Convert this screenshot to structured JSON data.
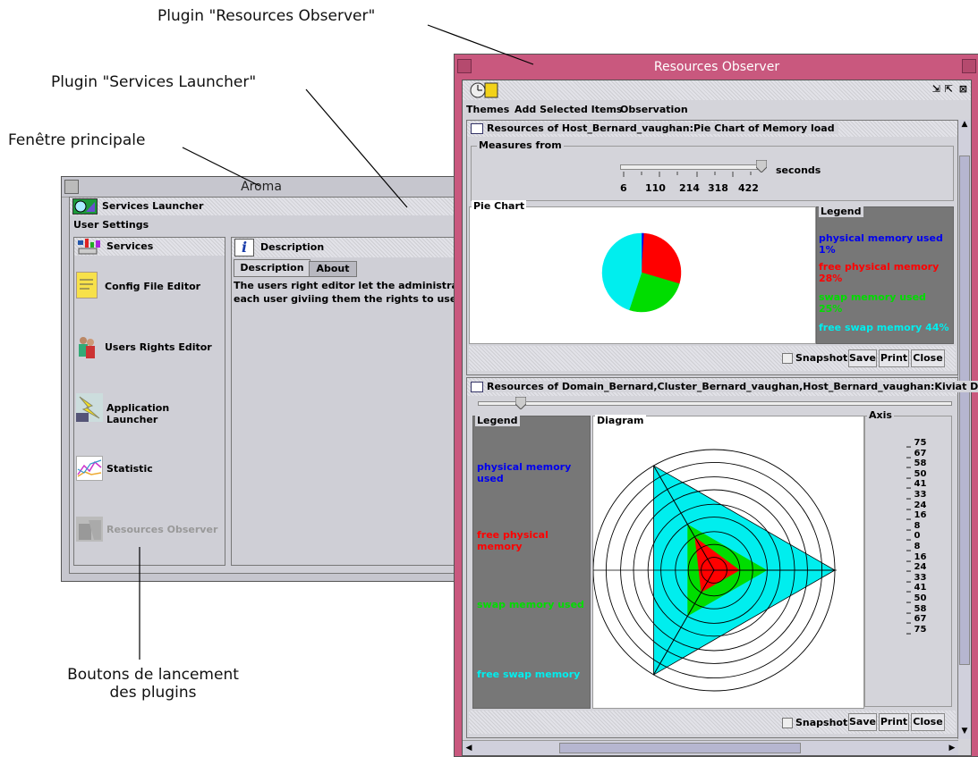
{
  "annotations": {
    "plugin_resources_observer": "Plugin \"Resources Observer\"",
    "plugin_services_launcher": "Plugin \"Services Launcher\"",
    "main_window": "Fenêtre principale",
    "launch_buttons_line1": "Boutons de lancement",
    "launch_buttons_line2": "des plugins"
  },
  "aroma": {
    "title": "Aroma",
    "launcher_title": "Services Launcher",
    "menu_user_settings": "User Settings",
    "services_header": "Services",
    "services": [
      {
        "label": "Config File Editor",
        "icon": "notepad-icon"
      },
      {
        "label": "Users Rights Editor",
        "icon": "people-icon"
      },
      {
        "label": "Application Launcher",
        "icon": "lightning-icon"
      },
      {
        "label": "Statistic",
        "icon": "chart-line-icon"
      },
      {
        "label": "Resources Observer",
        "icon": "observer-icon",
        "disabled": true
      }
    ],
    "description_header": "Description",
    "tabs": [
      "Description",
      "About"
    ],
    "description_text_line1": "The users right editor let the administrator to",
    "description_text_line2": "each user giviing them the rights to use servi"
  },
  "observer": {
    "title": "Resources Observer",
    "menu": [
      "Themes",
      "Add Selected Items",
      "Observation"
    ],
    "pie_panel": {
      "title": "Resources of Host_Bernard_vaughan:Pie Chart of Memory load",
      "measures_label": "Measures from",
      "slider_ticks": [
        "6",
        "110",
        "214",
        "318",
        "422"
      ],
      "slider_unit": "seconds",
      "chart_group_label": "Pie Chart",
      "legend_label": "Legend",
      "legend_items": [
        {
          "text": "physical memory used 1%",
          "color": "#0000ee"
        },
        {
          "text": "free physical memory 28%",
          "color": "#ff0000"
        },
        {
          "text": "swap memory used 25%",
          "color": "#00dd00"
        },
        {
          "text": "free swap memory 44%",
          "color": "#00eeee"
        }
      ],
      "snapshot_label": "Snapshot",
      "buttons": [
        "Save",
        "Print",
        "Close"
      ]
    },
    "kiviat_panel": {
      "title": "Resources of Domain_Bernard,Cluster_Bernard_vaughan,Host_Bernard_vaughan:Kiviat Diag...",
      "legend_label": "Legend",
      "diagram_label": "Diagram",
      "axis_label": "Axis",
      "legend_items": [
        {
          "text": "physical memory used",
          "color": "#0000ee"
        },
        {
          "text": "free physical memory",
          "color": "#ff0000"
        },
        {
          "text": "swap memory used",
          "color": "#00dd00"
        },
        {
          "text": "free swap memory",
          "color": "#00eeee"
        }
      ],
      "axis_ticks": [
        "75",
        "67",
        "58",
        "50",
        "41",
        "33",
        "24",
        "16",
        "8",
        "0",
        "8",
        "16",
        "24",
        "33",
        "41",
        "50",
        "58",
        "67",
        "75"
      ],
      "snapshot_label": "Snapshot",
      "buttons": [
        "Save",
        "Print",
        "Close"
      ]
    }
  },
  "chart_data": [
    {
      "type": "pie",
      "title": "",
      "categories": [
        "physical memory used",
        "free physical memory",
        "swap memory used",
        "free swap memory"
      ],
      "values": [
        1,
        28,
        25,
        44
      ],
      "colors": [
        "#0000ee",
        "#ff0000",
        "#00dd00",
        "#00eeee"
      ]
    },
    {
      "type": "radar",
      "title": "",
      "axes": 3,
      "series": [
        {
          "name": "free swap memory",
          "values": [
            75,
            75,
            75
          ],
          "color": "#00eeee"
        },
        {
          "name": "swap memory used",
          "values": [
            33,
            33,
            33
          ],
          "color": "#00dd00"
        },
        {
          "name": "free physical memory",
          "values": [
            24,
            16,
            16
          ],
          "color": "#ff0000"
        },
        {
          "name": "physical memory used",
          "values": [
            1,
            1,
            1
          ],
          "color": "#0000ee"
        }
      ]
    }
  ]
}
